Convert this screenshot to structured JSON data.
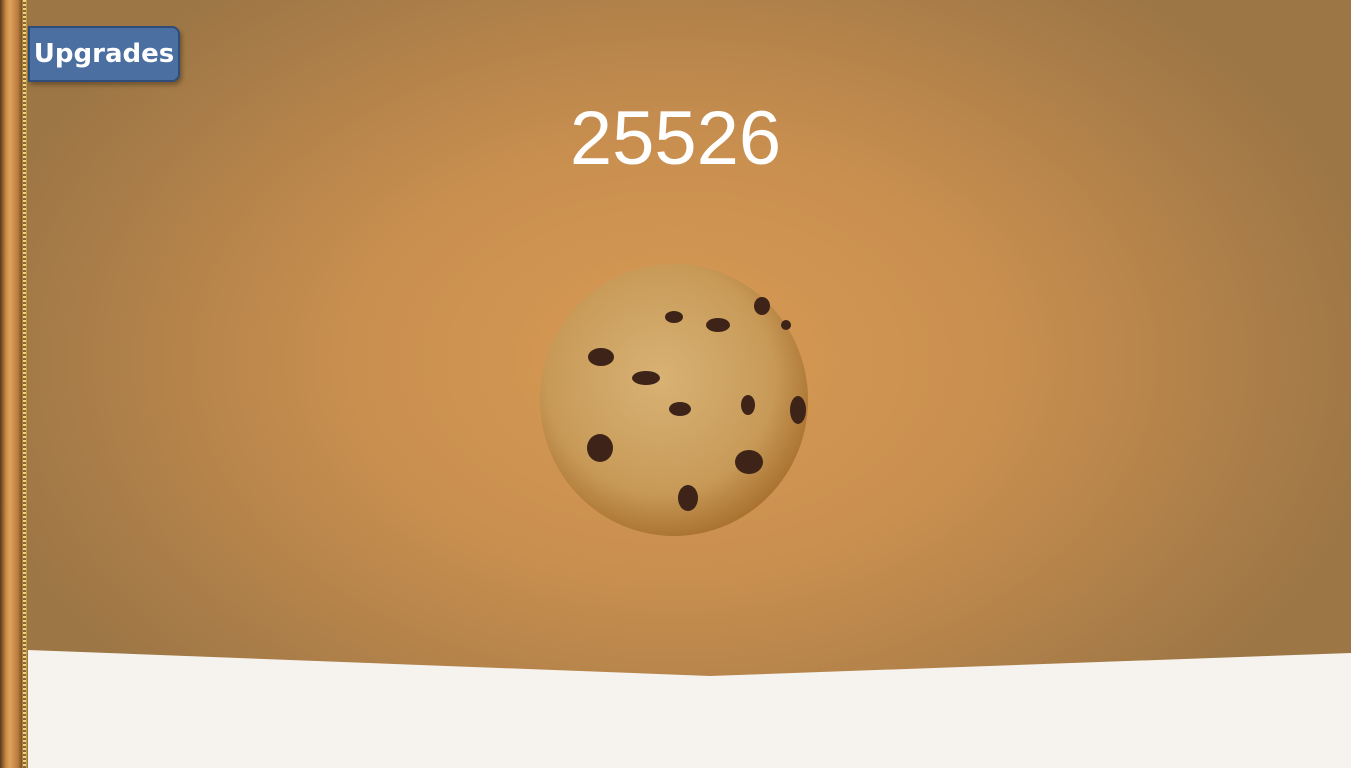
{
  "upgrades_button": {
    "label": "Upgrades"
  },
  "cookie_count": "25526",
  "colors": {
    "button": "#4a6fa0",
    "background": "#c98f4f",
    "milk": "#f6f3ee"
  }
}
